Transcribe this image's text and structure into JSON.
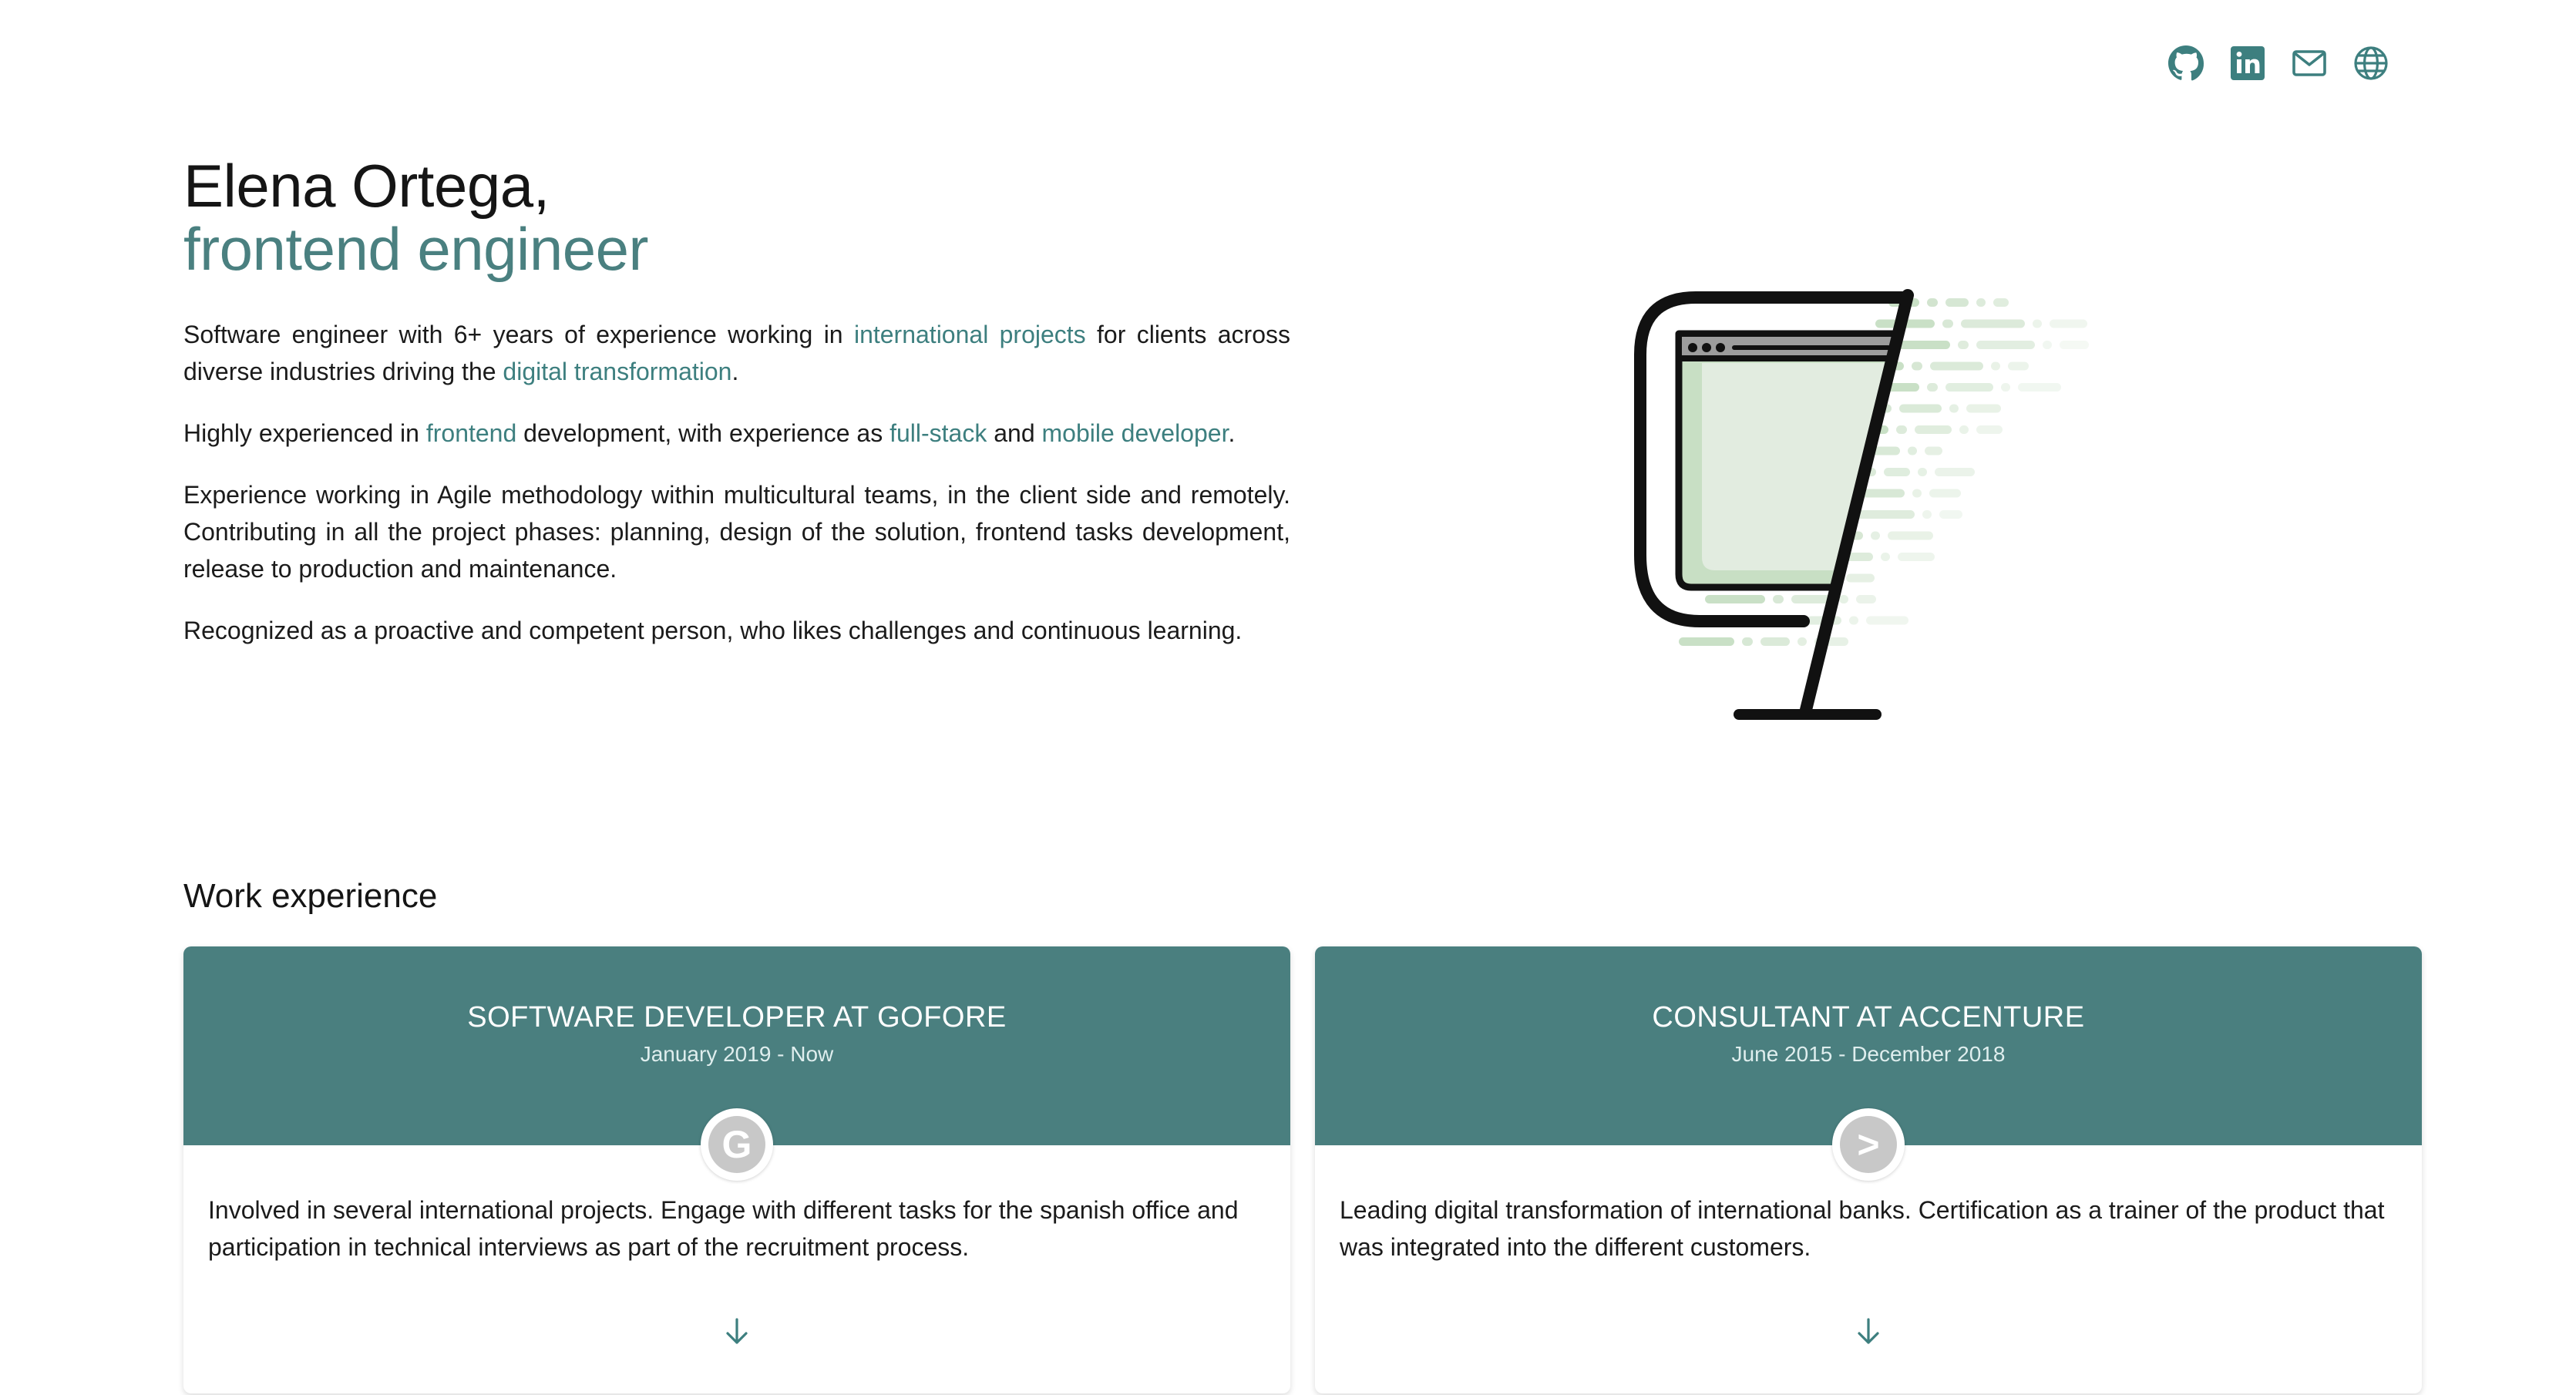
{
  "social": [
    {
      "icon": "github-icon"
    },
    {
      "icon": "linkedin-icon"
    },
    {
      "icon": "mail-icon"
    },
    {
      "icon": "globe-icon"
    }
  ],
  "intro": {
    "name": "Elena Ortega,",
    "role": "frontend engineer",
    "p1": {
      "t1": "Software engineer with 6+ years of experience working in ",
      "link1": "international projects",
      "t2": " for clients across diverse industries driving the ",
      "link2": "digital transformation",
      "t3": "."
    },
    "p2": {
      "t1": "Highly experienced in ",
      "link1": "frontend",
      "t2": " development, with experience as ",
      "link2": "full-stack",
      "t3": " and ",
      "link3": "mobile developer",
      "t4": "."
    },
    "p3": "Experience working in Agile methodology within multicultural teams, in the client side and remotely. Contributing in all the project phases: planning, design of the solution, frontend tasks development, release to production and maintenance.",
    "p4": "Recognized as a proactive and competent person, who likes challenges and continuous learning."
  },
  "work": {
    "title": "Work experience",
    "jobs": [
      {
        "title": "SOFTWARE DEVELOPER AT GOFORE",
        "dates": "January 2019 - Now",
        "logo_letter": "G",
        "description": "Involved in several international projects. Engage with different tasks for the spanish office and participation in technical interviews as part of the recruitment process."
      },
      {
        "title": "CONSULTANT AT ACCENTURE",
        "dates": "June 2015 - December 2018",
        "logo_letter": ">",
        "description": "Leading digital transformation of international banks. Certification as a trainer of the product that was integrated into the different customers."
      }
    ]
  },
  "colors": {
    "accent": "#3d7f7f",
    "card_header": "#4a7f7f",
    "illustration_green": "#c8dfc4"
  }
}
